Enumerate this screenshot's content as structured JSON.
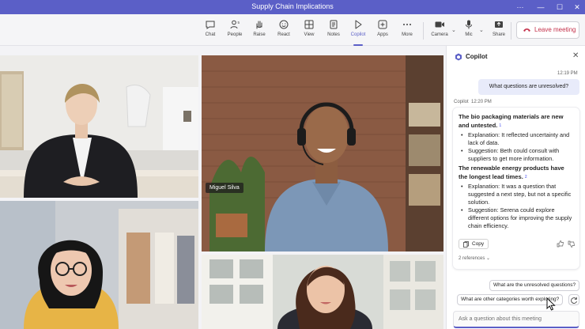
{
  "window": {
    "title": "Supply Chain Implications"
  },
  "toolbar": {
    "buttons": [
      {
        "label": "Chat",
        "icon": "chat-icon"
      },
      {
        "label": "People",
        "icon": "people-icon",
        "badge": "5"
      },
      {
        "label": "Raise",
        "icon": "raise-hand-icon"
      },
      {
        "label": "React",
        "icon": "react-icon"
      },
      {
        "label": "View",
        "icon": "view-icon"
      },
      {
        "label": "Notes",
        "icon": "notes-icon"
      },
      {
        "label": "Copilot",
        "icon": "copilot-icon"
      },
      {
        "label": "Apps",
        "icon": "apps-icon"
      },
      {
        "label": "More",
        "icon": "more-icon"
      },
      {
        "label": "Camera",
        "icon": "camera-icon"
      },
      {
        "label": "Mic",
        "icon": "mic-icon"
      },
      {
        "label": "Share",
        "icon": "share-icon"
      }
    ],
    "leave_label": "Leave meeting"
  },
  "participants": [
    {
      "name": ""
    },
    {
      "name": "Miguel Silva"
    },
    {
      "name": ""
    },
    {
      "name": ""
    }
  ],
  "copilot": {
    "title": "Copilot",
    "user_time": "12:19 PM",
    "user_question": "What questions are unresolved?",
    "bot_name": "Copilot",
    "bot_time": "12:20 PM",
    "answer": {
      "section1_title": "The bio packaging materials are new and untested.",
      "section1_ref": "1",
      "section1_items": [
        "Explanation: It reflected uncertainty and lack of data.",
        "Suggestion: Beth could consult with suppliers to get more information."
      ],
      "section2_title": "The renewable energy products have the longest lead times.",
      "section2_ref": "2",
      "section2_items": [
        "Explanation: It was a question that suggested a next step, but not a specific solution.",
        "Suggestion: Serena could explore different options for improving the supply chain efficiency."
      ]
    },
    "copy_label": "Copy",
    "references_label": "2 references",
    "suggestions": [
      "What are the unresolved questions?",
      "What are other categories worth exploring?"
    ],
    "ask_placeholder": "Ask a question about this meeting"
  },
  "colors": {
    "accent": "#5b5fc7",
    "leave": "#c4314b",
    "titlebar": "#5b5fc7"
  }
}
